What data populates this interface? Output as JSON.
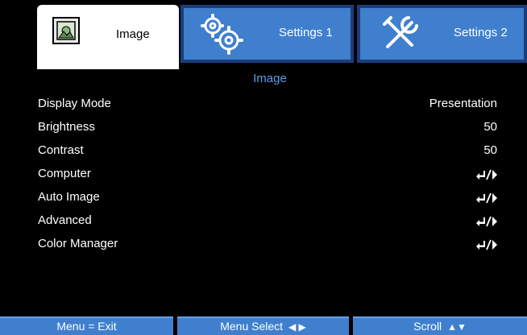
{
  "tabs": [
    {
      "label": "Image",
      "icon": "image-icon"
    },
    {
      "label": "Settings 1",
      "icon": "gears-icon"
    },
    {
      "label": "Settings 2",
      "icon": "tools-icon"
    }
  ],
  "section_title": "Image",
  "rows": [
    {
      "label": "Display Mode",
      "value": "Presentation"
    },
    {
      "label": "Brightness",
      "value": "50"
    },
    {
      "label": "Contrast",
      "value": "50"
    },
    {
      "label": "Computer",
      "value": "",
      "icon": "enter-arrow-icon"
    },
    {
      "label": "Auto Image",
      "value": "",
      "icon": "enter-arrow-icon"
    },
    {
      "label": "Advanced",
      "value": "",
      "icon": "enter-arrow-icon"
    },
    {
      "label": "Color Manager",
      "value": "",
      "icon": "enter-arrow-icon"
    }
  ],
  "footer": {
    "exit": "Menu = Exit",
    "select": "Menu Select",
    "select_glyph": "◀ ▶",
    "scroll": "Scroll",
    "scroll_glyph": "▲▼"
  },
  "colors": {
    "accent": "#3f7fce",
    "title": "#5f9ae6",
    "background": "#000000"
  }
}
